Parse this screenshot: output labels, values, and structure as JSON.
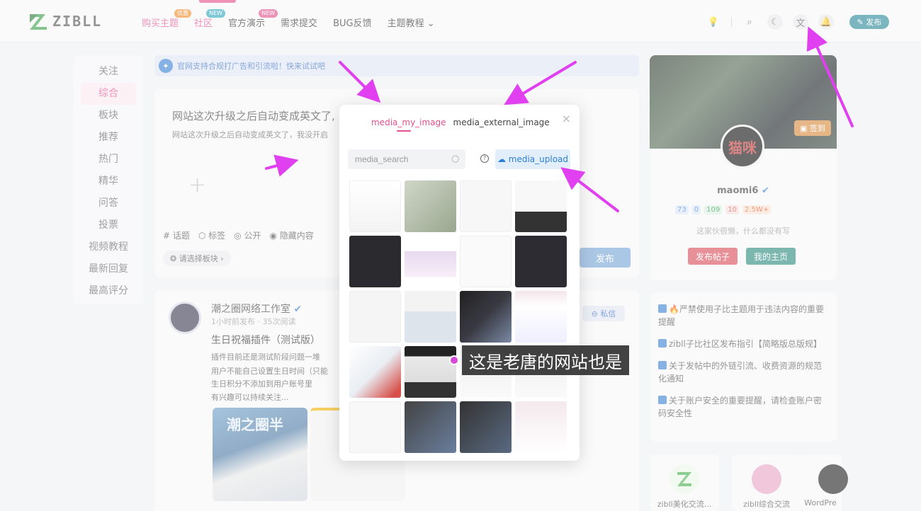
{
  "header": {
    "logo_text": "ZIBLL",
    "nav": [
      {
        "label": "购买主题",
        "badge": "优惠",
        "badge_color": "#f08a2c"
      },
      {
        "label": "社区",
        "badge": "NEW",
        "badge_color": "#2fa6c0"
      },
      {
        "label": "官方演示",
        "badge": "NEW",
        "badge_color": "#e4508d"
      },
      {
        "label": "需求提交"
      },
      {
        "label": "BUG反馈"
      },
      {
        "label": "主题教程 ⌄"
      }
    ],
    "publish_label": "✎ 发布"
  },
  "left_menu": [
    "关注",
    "综合",
    "板块",
    "推荐",
    "热门",
    "精华",
    "问答",
    "投票",
    "视频教程",
    "最新回复",
    "最高评分"
  ],
  "notice": "官网支持合规打广告和引流啦！快来试试吧",
  "editor": {
    "title": "网站这次升级之后自动变成英文了,",
    "body": "网站这次升级之后自动变成英文了，我没开启",
    "tools": [
      "# 话题",
      "⬡ 标签",
      "◎ 公开",
      "◉ 隐藏内容"
    ],
    "board": "❂ 请选择板块 ›",
    "submit": "发布"
  },
  "post": {
    "author": "潮之圈网络工作室",
    "meta": "1小时前发布 · 35次阅读",
    "title": "生日祝福插件（测试版）",
    "lines": [
      "插件目前还是测试阶段问题一堆",
      "用户不能自己设置生日时间（只能",
      "生日积分不添加到用户账号里",
      "有兴趣可以持续关注..."
    ],
    "private_label": "⊖ 私信",
    "img1_text": "潮之圈半"
  },
  "profile": {
    "avatar_text": "猫咪",
    "signin": "签到",
    "name": "maomi6",
    "stats": [
      {
        "text": "73",
        "color": "#3b82d6",
        "bg": "#dbe7f7"
      },
      {
        "text": "0",
        "color": "#3b82d6",
        "bg": "#dbe7f7"
      },
      {
        "text": "109",
        "color": "#2e9a4e",
        "bg": "#d9efe0"
      },
      {
        "text": "10",
        "color": "#d9534f",
        "bg": "#f7dede"
      },
      {
        "text": "2.5W+",
        "color": "#e85a1f",
        "bg": "#fbe4d9"
      }
    ],
    "desc": "这家伙很懒，什么都没有写",
    "btn_post": "发布帖子",
    "btn_home": "我的主页"
  },
  "side_notices": [
    "🔥严禁使用子比主题用于违法内容的重要提醒",
    "zibll子比社区发布指引【简略版总版规】",
    "关于发帖中的外链引流、收费资源的规范化通知",
    "关于账户安全的重要提醒，请检查账户密码安全性"
  ],
  "groups": [
    {
      "label": "zibll美化交流...",
      "color": "#4caf50"
    },
    {
      "label": "zibll综合交流",
      "color": "#e8a5c7"
    },
    {
      "label": "WordPre",
      "color": "#222222"
    }
  ],
  "modal": {
    "tab_my": "media_my_image",
    "tab_external": "media_external_image",
    "close": "×",
    "search_placeholder": "media_search",
    "help": "?",
    "upload": "media_upload"
  },
  "caption": "这是老唐的网站也是",
  "colors": {
    "accent": "#e4508d",
    "brand": "#2a8a99",
    "arrow": "#e040f0"
  }
}
